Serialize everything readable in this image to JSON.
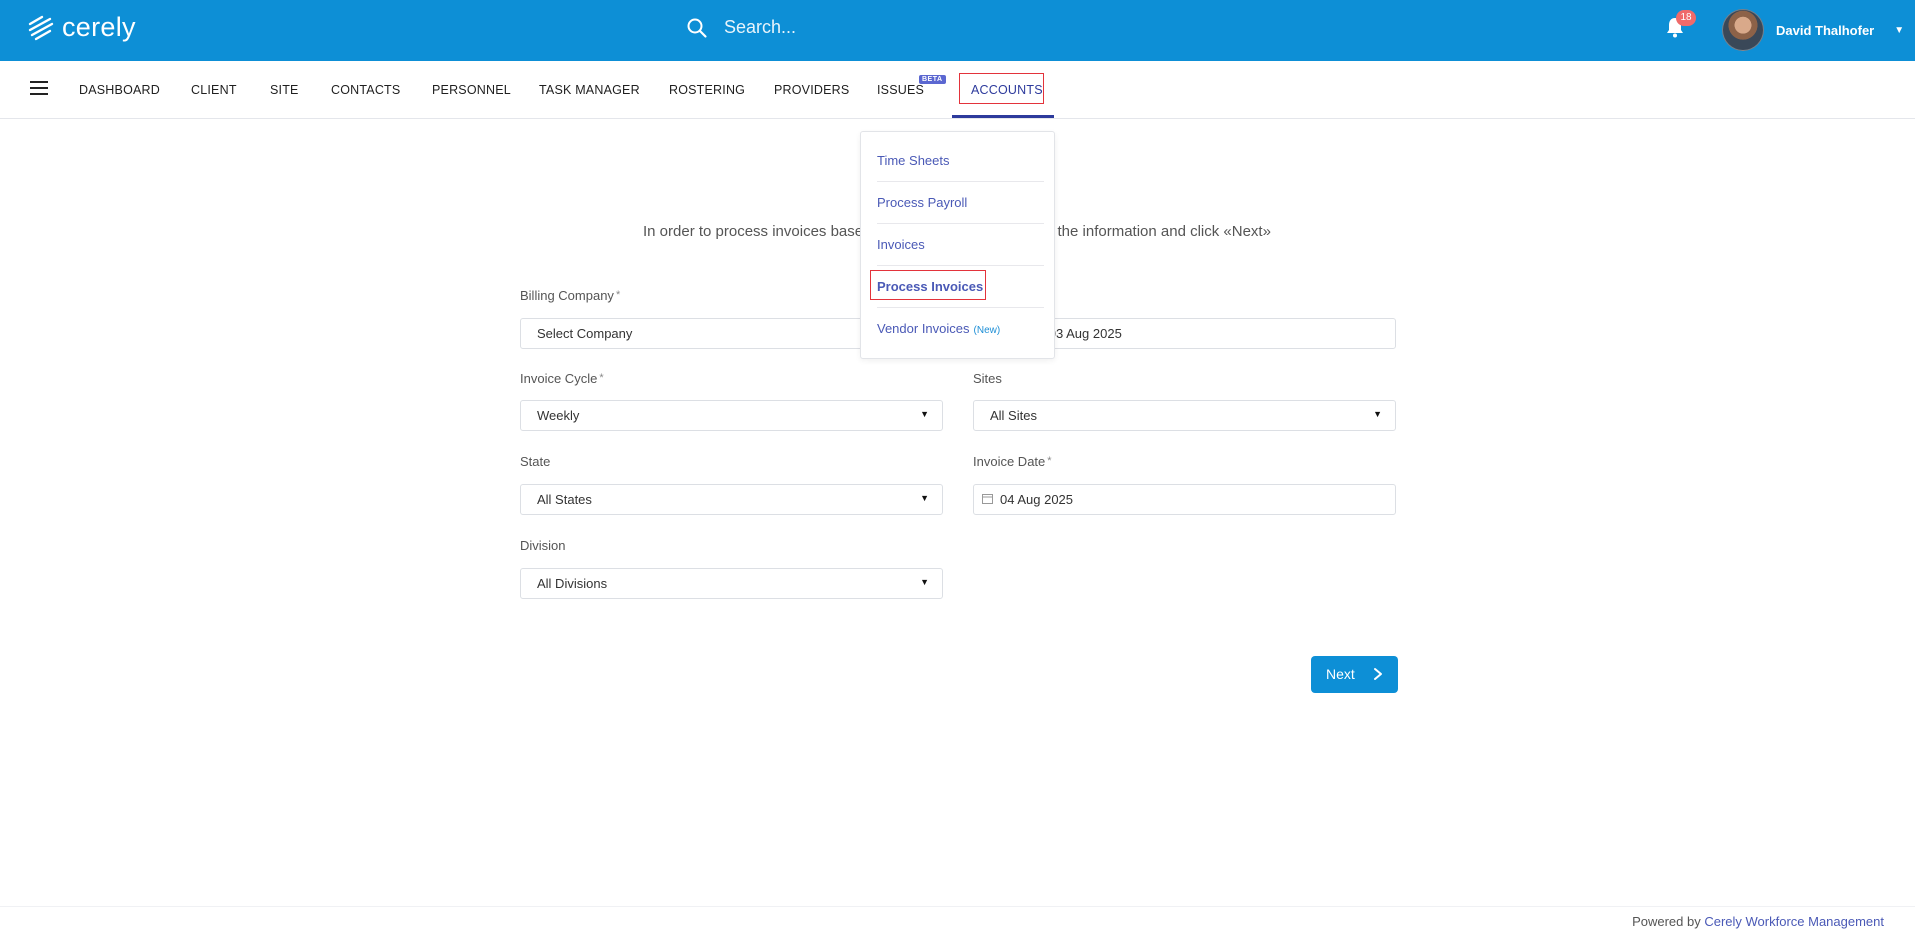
{
  "header": {
    "logo_text": "cerely",
    "search_placeholder": "Search...",
    "notification_count": "18",
    "user_name": "David Thalhofer"
  },
  "nav": {
    "items": [
      "DASHBOARD",
      "CLIENT",
      "SITE",
      "CONTACTS",
      "PERSONNEL",
      "TASK MANAGER",
      "ROSTERING",
      "PROVIDERS",
      "ISSUES",
      "ACCOUNTS"
    ],
    "beta_label": "BETA",
    "active": "ACCOUNTS"
  },
  "accounts_menu": {
    "items": [
      "Time Sheets",
      "Process Payroll",
      "Invoices",
      "Process Invoices",
      "Vendor Invoices"
    ],
    "new_tag": "(New)",
    "highlighted": "Process Invoices"
  },
  "form": {
    "intro_left": "In order to process invoices base",
    "intro_right": "l the information and click «Next»",
    "billing_company_label": "Billing Company",
    "billing_company_value": "Select Company",
    "period_value": "5 - 03 Aug 2025",
    "invoice_cycle_label": "Invoice Cycle",
    "invoice_cycle_value": "Weekly",
    "sites_label": "Sites",
    "sites_value": "All Sites",
    "state_label": "State",
    "state_value": "All States",
    "invoice_date_label": "Invoice Date",
    "invoice_date_value": "04 Aug 2025",
    "division_label": "Division",
    "division_value": "All Divisions",
    "required_mark": "*",
    "next_label": "Next"
  },
  "footer": {
    "powered_by": "Powered by ",
    "link_text": "Cerely Workforce Management"
  },
  "colors": {
    "brand_blue": "#0d8fd6",
    "nav_active": "#2d3a9c",
    "link": "#4a59b6",
    "highlight_border": "#e3333b"
  }
}
